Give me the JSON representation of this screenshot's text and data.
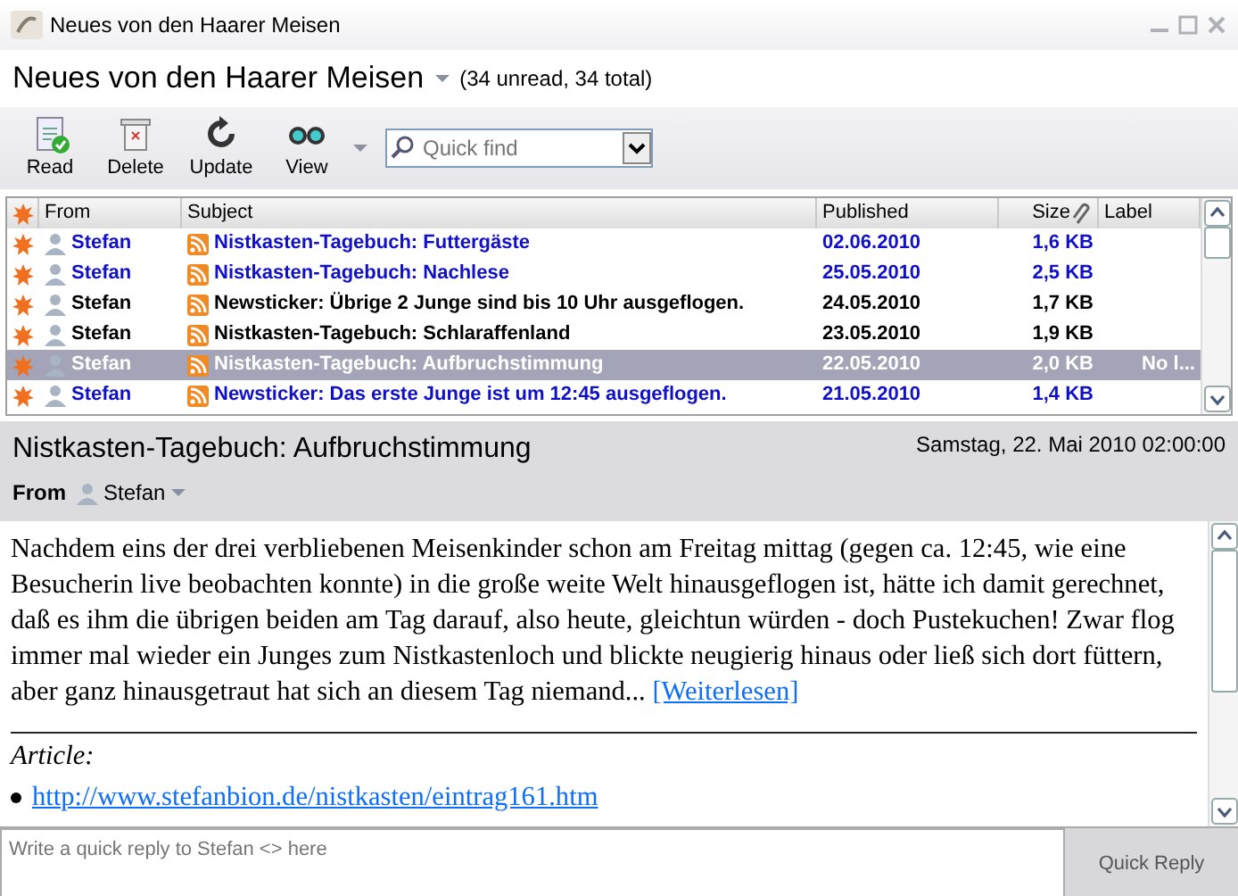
{
  "window": {
    "title": "Neues von den Haarer Meisen"
  },
  "feed": {
    "title": "Neues von den Haarer Meisen",
    "counts": "(34 unread, 34 total)"
  },
  "toolbar": {
    "buttons": [
      {
        "label": "Read",
        "kind": "read"
      },
      {
        "label": "Delete",
        "kind": "delete"
      },
      {
        "label": "Update",
        "kind": "update"
      },
      {
        "label": "View",
        "kind": "view"
      }
    ],
    "search": {
      "placeholder": "Quick find"
    }
  },
  "table": {
    "columns": [
      "From",
      "Subject",
      "Published",
      "Size",
      "Label"
    ],
    "rows": [
      {
        "from": "Stefan",
        "subject": "Nistkasten-Tagebuch: Futtergäste",
        "published": "02.06.2010",
        "size": "1,6 KB",
        "label": "",
        "unread": true,
        "selected": false
      },
      {
        "from": "Stefan",
        "subject": "Nistkasten-Tagebuch: Nachlese",
        "published": "25.05.2010",
        "size": "2,5 KB",
        "label": "",
        "unread": true,
        "selected": false
      },
      {
        "from": "Stefan",
        "subject": "Newsticker: Übrige 2 Junge sind bis 10 Uhr ausgeflogen.",
        "published": "24.05.2010",
        "size": "1,7 KB",
        "label": "",
        "unread": false,
        "selected": false
      },
      {
        "from": "Stefan",
        "subject": "Nistkasten-Tagebuch: Schlaraffenland",
        "published": "23.05.2010",
        "size": "1,9 KB",
        "label": "",
        "unread": false,
        "selected": false
      },
      {
        "from": "Stefan",
        "subject": "Nistkasten-Tagebuch: Aufbruchstimmung",
        "published": "22.05.2010",
        "size": "2,0 KB",
        "label": "No l...",
        "unread": false,
        "selected": true
      },
      {
        "from": "Stefan",
        "subject": "Newsticker: Das erste Junge ist um 12:45 ausgeflogen.",
        "published": "21.05.2010",
        "size": "1,4 KB",
        "label": "",
        "unread": true,
        "selected": false
      }
    ]
  },
  "preview": {
    "title": "Nistkasten-Tagebuch: Aufbruchstimmung",
    "date": "Samstag, 22. Mai 2010 02:00:00",
    "from_label": "From",
    "from": "Stefan",
    "summary": "Nachdem eins der drei verbliebenen Meisenkinder schon am Freitag mittag (gegen ca. 12:45, wie eine Besucherin live beobachten konnte) in die große weite Welt hinausgeflogen ist, hätte ich damit gerechnet, daß es ihm die übrigen beiden am Tag darauf, also heute, gleichtun würden - doch Pustekuchen! Zwar flog immer mal wieder ein Junges zum Nistkastenloch und blickte neugierig hinaus oder ließ sich dort füttern, aber ganz hinausgetraut hat sich an diesem Tag niemand...",
    "read_more": "[Weiterlesen]",
    "article_label": "Article:",
    "links": [
      "http://www.stefanbion.de/nistkasten/eintrag161.htm"
    ]
  },
  "reply": {
    "placeholder": "Write a quick reply to Stefan <> here",
    "button": "Quick Reply"
  }
}
